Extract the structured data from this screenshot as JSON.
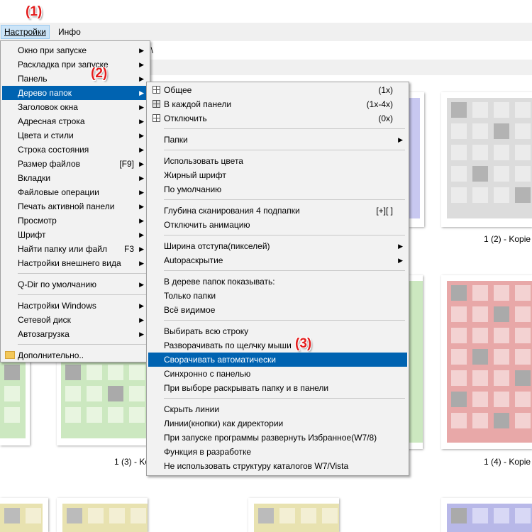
{
  "menubar": {
    "settings": "Настройки",
    "info": "Инфо"
  },
  "address": {
    "text": "2\\"
  },
  "annotations": {
    "a1": "(1)",
    "a2": "(2)",
    "a3": "(3)"
  },
  "menu1": {
    "items": [
      {
        "label": "Окно при запуске",
        "arrow": true
      },
      {
        "label": "Раскладка при запуске",
        "arrow": true
      },
      {
        "label": "Панель",
        "arrow": true
      },
      {
        "label": "Дерево папок",
        "arrow": true,
        "highlighted": true
      },
      {
        "label": "Заголовок окна",
        "arrow": true
      },
      {
        "label": "Адресная строка",
        "arrow": true
      },
      {
        "label": "Цвета и стили",
        "arrow": true
      },
      {
        "label": "Строка состояния",
        "arrow": true
      },
      {
        "label": "Размер файлов",
        "shortcut": "[F9]",
        "arrow": true
      },
      {
        "label": "Вкладки",
        "arrow": true
      },
      {
        "label": "Файловые операции",
        "arrow": true
      },
      {
        "label": "Печать активной панели",
        "arrow": true
      },
      {
        "label": "Просмотр",
        "arrow": true
      },
      {
        "label": "Шрифт",
        "arrow": true
      },
      {
        "label": "Найти папку или файл",
        "shortcut": "F3",
        "arrow": true
      },
      {
        "label": "Настройки внешнего вида",
        "arrow": true
      },
      {
        "label": "Q-Dir по умолчанию",
        "arrow": true
      },
      {
        "label": "Настройки Windows",
        "arrow": true
      },
      {
        "label": "Сетевой диск",
        "arrow": true
      },
      {
        "label": "Автозагрузка",
        "arrow": true
      },
      {
        "label": "Дополнительно..",
        "arrow": false
      }
    ]
  },
  "menu2": {
    "items": [
      {
        "label": "Общее",
        "shortcut": "(1x)"
      },
      {
        "label": "В каждой панели",
        "shortcut": "(1x-4x)"
      },
      {
        "label": "Отключить",
        "shortcut": "(0x)"
      },
      {
        "label": "Папки",
        "arrow": true
      },
      {
        "label": "Использовать цвета"
      },
      {
        "label": "Жирный шрифт"
      },
      {
        "label": "По умолчанию"
      },
      {
        "label": "Глубина сканирования 4 подпапки",
        "shortcut": "[+][ ]"
      },
      {
        "label": "Отключить анимацию"
      },
      {
        "label": "Ширина отступа(пикселей)",
        "arrow": true
      },
      {
        "label": "Autoраскрытие",
        "arrow": true
      },
      {
        "label": "В дереве папок показывать:"
      },
      {
        "label": "Только папки"
      },
      {
        "label": "Всё видимое"
      },
      {
        "label": "Выбирать всю строку"
      },
      {
        "label": "Разворачивать по щелчку мыши"
      },
      {
        "label": "Сворачивать автоматически",
        "highlighted": true
      },
      {
        "label": "Синхронно с панелью"
      },
      {
        "label": "При выборе раскрывать папку и в панели"
      },
      {
        "label": "Скрыть линии"
      },
      {
        "label": "Линии(кнопки) как директории"
      },
      {
        "label": "При запуске программы развернуть Избранное(W7/8)"
      },
      {
        "label": "Функция в разработке"
      },
      {
        "label": "Не использовать структуру каталогов W7/Vista"
      }
    ]
  },
  "tiles": {
    "label_2": "1 (2) - Kopie",
    "label_3": "1 (3) - Ko",
    "label_4": "1 (4) - Kopie"
  },
  "colors": {
    "highlight": "#0063b1",
    "annotation": "#e31d1d"
  }
}
